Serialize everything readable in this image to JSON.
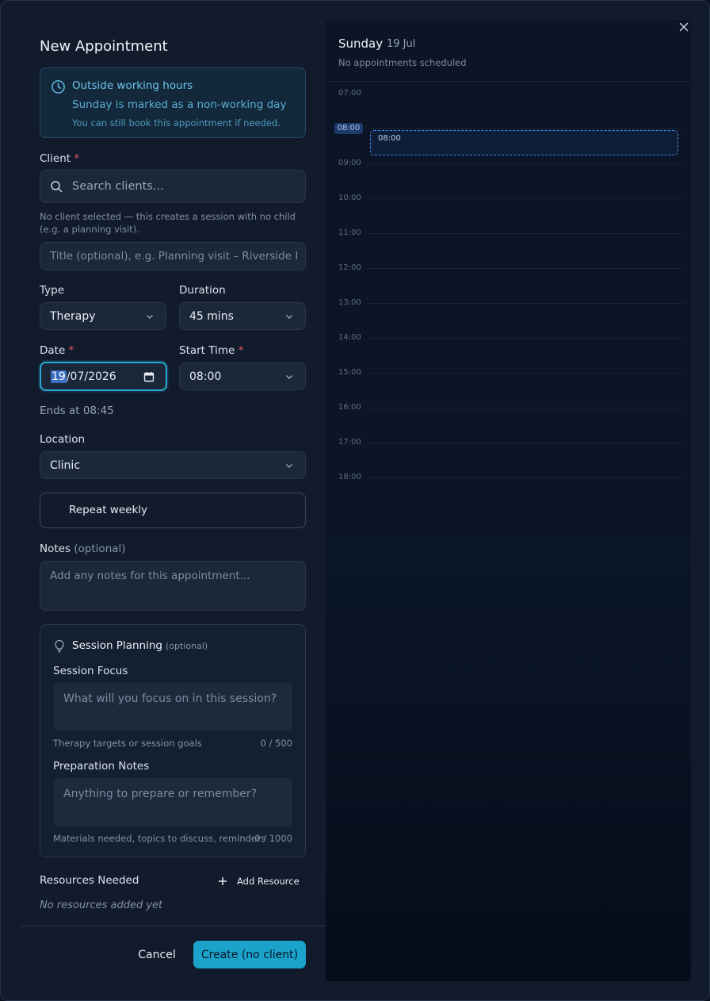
{
  "dialog": {
    "title": "New Appointment"
  },
  "alert": {
    "title": "Outside working hours",
    "subtitle": "Sunday is marked as a non-working day",
    "note": "You can still book this appointment if needed."
  },
  "client": {
    "label": "Client",
    "required_mark": "*",
    "search_placeholder": "Search clients...",
    "helper": "No client selected — this creates a session with no child (e.g. a planning visit)."
  },
  "title_field": {
    "placeholder": "Title (optional), e.g. Planning visit – Riverside Primary"
  },
  "type": {
    "label": "Type",
    "value": "Therapy"
  },
  "duration": {
    "label": "Duration",
    "value": "45 mins"
  },
  "date": {
    "label": "Date",
    "required_mark": "*",
    "day": "19",
    "rest": "/07/2026"
  },
  "start_time": {
    "label": "Start Time",
    "required_mark": "*",
    "value": "08:00"
  },
  "ends_at": "Ends at 08:45",
  "location": {
    "label": "Location",
    "value": "Clinic"
  },
  "repeat": {
    "label": "Repeat weekly"
  },
  "notes": {
    "label": "Notes",
    "optional": "(optional)",
    "placeholder": "Add any notes for this appointment..."
  },
  "planning": {
    "title": "Session Planning",
    "optional": "(optional)",
    "focus_label": "Session Focus",
    "focus_placeholder": "What will you focus on in this session?",
    "focus_helper": "Therapy targets or session goals",
    "focus_count": "0 / 500",
    "prep_label": "Preparation Notes",
    "prep_placeholder": "Anything to prepare or remember?",
    "prep_helper": "Materials needed, topics to discuss, reminders",
    "prep_count": "0 / 1000"
  },
  "resources": {
    "label": "Resources Needed",
    "add_label": "Add Resource",
    "empty": "No resources added yet"
  },
  "footer": {
    "cancel": "Cancel",
    "create": "Create (no client)"
  },
  "calendar": {
    "day": "Sunday",
    "date": "19 Jul",
    "subtitle": "No appointments scheduled",
    "hours": [
      "07:00",
      "08:00",
      "09:00",
      "10:00",
      "11:00",
      "12:00",
      "13:00",
      "14:00",
      "15:00",
      "16:00",
      "17:00",
      "18:00"
    ],
    "active_hour": "08:00",
    "slot_label": "08:00"
  },
  "colors": {
    "accent": "#1ba3cc",
    "alert_text": "#6cc6ea",
    "required": "#e45a6a",
    "slot_border": "#3a8cf2"
  }
}
